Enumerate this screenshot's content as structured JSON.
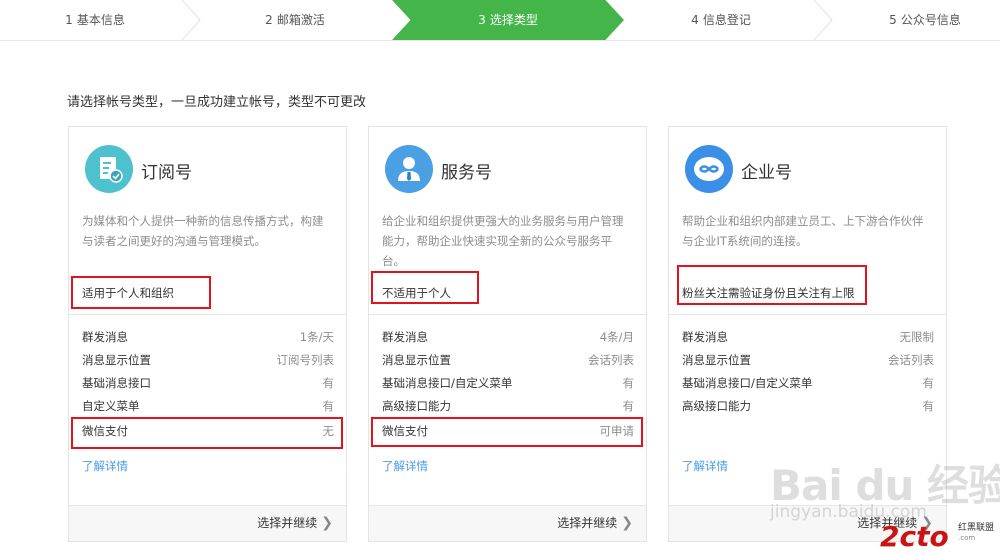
{
  "steps": [
    {
      "num": "1",
      "label": "基本信息"
    },
    {
      "num": "2",
      "label": "邮箱激活"
    },
    {
      "num": "3",
      "label": "选择类型"
    },
    {
      "num": "4",
      "label": "信息登记"
    },
    {
      "num": "5",
      "label": "公众号信息"
    }
  ],
  "active_step": 3,
  "instruction": "请选择帐号类型，一旦成功建立帐号，类型不可更改",
  "cards": [
    {
      "title": "订阅号",
      "icon": "subscription-doc-icon",
      "icon_color": "#4ec1cf",
      "desc": "为媒体和个人提供一种新的信息传播方式，构建与读者之间更好的沟通与管理模式。",
      "note": "适用于个人和组织",
      "features": [
        {
          "k": "群发消息",
          "v": "1条/天"
        },
        {
          "k": "消息显示位置",
          "v": "订阅号列表"
        },
        {
          "k": "基础消息接口",
          "v": "有"
        },
        {
          "k": "自定义菜单",
          "v": "有"
        },
        {
          "k": "微信支付",
          "v": "无"
        }
      ],
      "learn": "了解详情",
      "continue": "选择并继续"
    },
    {
      "title": "服务号",
      "icon": "service-person-icon",
      "icon_color": "#4aa0e3",
      "desc": "给企业和组织提供更强大的业务服务与用户管理能力，帮助企业快速实现全新的公众号服务平台。",
      "note": "不适用于个人",
      "features": [
        {
          "k": "群发消息",
          "v": "4条/月"
        },
        {
          "k": "消息显示位置",
          "v": "会话列表"
        },
        {
          "k": "基础消息接口/自定义菜单",
          "v": "有"
        },
        {
          "k": "高级接口能力",
          "v": "有"
        },
        {
          "k": "微信支付",
          "v": "可申请"
        }
      ],
      "learn": "了解详情",
      "continue": "选择并继续"
    },
    {
      "title": "企业号",
      "icon": "enterprise-link-icon",
      "icon_color": "#3b8fe6",
      "desc": "帮助企业和组织内部建立员工、上下游合作伙伴与企业IT系统间的连接。",
      "note": "粉丝关注需验证身份且关注有上限",
      "features": [
        {
          "k": "群发消息",
          "v": "无限制"
        },
        {
          "k": "消息显示位置",
          "v": "会话列表"
        },
        {
          "k": "基础消息接口/自定义菜单",
          "v": "有"
        },
        {
          "k": "高级接口能力",
          "v": "有"
        }
      ],
      "learn": "了解详情",
      "continue": "选择并继续"
    }
  ],
  "colors": {
    "active_step_bg": "#44b549",
    "highlight_red": "#e0131e",
    "link_blue": "#459ae9"
  },
  "watermarks": {
    "baidu": "Bai du 经验",
    "baidu_url": "jingyan.baidu.com",
    "site": "2cto",
    "site_cn": "红黑联盟",
    "site_en": ".com"
  }
}
